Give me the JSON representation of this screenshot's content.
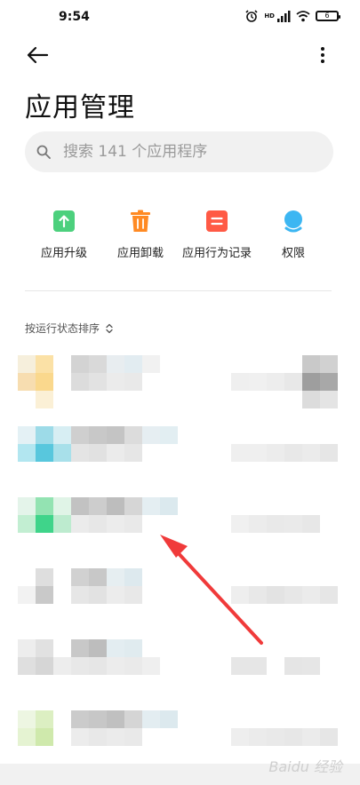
{
  "status": {
    "time": "9:54",
    "hd": "HD",
    "battery": "6"
  },
  "page": {
    "title": "应用管理"
  },
  "search": {
    "placeholder": "搜索 141 个应用程序"
  },
  "quick_actions": [
    {
      "label": "应用升级",
      "icon": "upgrade-icon",
      "color": "#4cd07d"
    },
    {
      "label": "应用卸载",
      "icon": "trash-icon",
      "color": "#ff8a23"
    },
    {
      "label": "应用行为记录",
      "icon": "record-icon",
      "color": "#ff5a45"
    },
    {
      "label": "权限",
      "icon": "permission-icon",
      "color": "#3cb6f2"
    }
  ],
  "sort": {
    "label": "按运行状态排序"
  },
  "watermark": {
    "text": "Baidu 经验"
  }
}
